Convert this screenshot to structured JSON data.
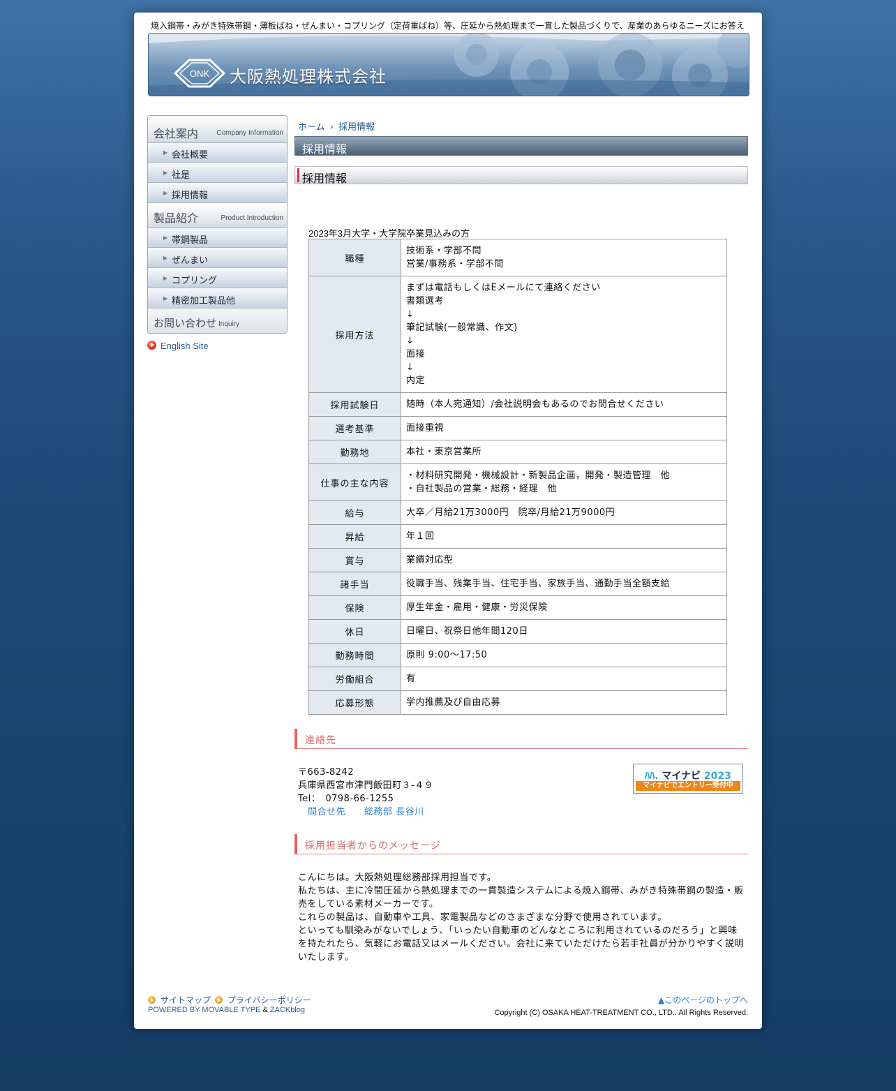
{
  "header": {
    "tagline": "焼入鋼帯・みがき特殊帯鋼・薄板ばね・ぜんまい・コプリング（定荷重ばね）等、圧延から熱処理まで一貫した製品づくりで、産業のあらゆるニーズにお答え",
    "logo_text": "ONK",
    "company_name": "大阪熱処理株式会社"
  },
  "sidebar": {
    "company": {
      "jp": "会社案内",
      "en": "Company Information"
    },
    "company_items": [
      {
        "label": "会社概要"
      },
      {
        "label": "社是"
      },
      {
        "label": "採用情報"
      }
    ],
    "products": {
      "jp": "製品紹介",
      "en": "Product Introduction"
    },
    "product_items": [
      {
        "label": "帯鋼製品"
      },
      {
        "label": "ぜんまい"
      },
      {
        "label": "コプリング"
      },
      {
        "label": "精密加工製品他"
      }
    ],
    "inquiry": {
      "jp": "お問い合わせ",
      "en": "Inquiry"
    },
    "english_link": "English Site"
  },
  "breadcrumb": {
    "home": "ホーム",
    "sep": "›",
    "current": "採用情報"
  },
  "page_title": "採用情報",
  "section_title": "採用情報",
  "table_caption": "2023年3月大学・大学院卒業見込みの方",
  "table_rows": [
    {
      "head": "職種",
      "lines": [
        "技術系・学部不問",
        "営業/事務系・学部不問"
      ]
    },
    {
      "head": "採用方法",
      "lines": [
        "まずは電話もしくはEメールにて連絡ください",
        "書類選考",
        "↓",
        "筆記試験(一般常識、作文)",
        "↓",
        "面接",
        "↓",
        "内定"
      ]
    },
    {
      "head": "採用試験日",
      "lines": [
        "随時（本人宛通知）/会社説明会もあるのでお問合せください"
      ]
    },
    {
      "head": "選考基準",
      "lines": [
        "面接重視"
      ]
    },
    {
      "head": "勤務地",
      "lines": [
        "本社・東京営業所"
      ]
    },
    {
      "head": "仕事の主な内容",
      "lines": [
        "・材料研究開発・機械設計・新製品企画，開発・製造管理　他",
        "・自社製品の営業・総務・経理　他"
      ]
    },
    {
      "head": "給与",
      "lines": [
        "大卒／月給21万3000円　院卒/月給21万9000円"
      ]
    },
    {
      "head": "昇給",
      "lines": [
        "年１回"
      ]
    },
    {
      "head": "賞与",
      "lines": [
        "業績対応型"
      ]
    },
    {
      "head": "諸手当",
      "lines": [
        "役職手当、残業手当、住宅手当、家族手当、通勤手当全額支給"
      ]
    },
    {
      "head": "保険",
      "lines": [
        "厚生年金・雇用・健康・労災保険"
      ]
    },
    {
      "head": "休日",
      "lines": [
        "日曜日、祝祭日他年間120日"
      ]
    },
    {
      "head": "勤務時間",
      "lines": [
        "原則 9:00～17:50"
      ]
    },
    {
      "head": "労働組合",
      "lines": [
        "有"
      ]
    },
    {
      "head": "応募形態",
      "lines": [
        "学内推薦及び自由応募"
      ]
    }
  ],
  "contact": {
    "heading": "連絡先",
    "postal": "〒663-8242",
    "address": "兵庫県西宮市津門飯田町３-４９",
    "tel": "Tel：　0798-66-1255",
    "link": "問合せ先　　総務部 長谷川"
  },
  "mynavi": {
    "brand": "マイナビ",
    "year": "2023",
    "entry": "マイナビでエントリー受付中"
  },
  "message": {
    "heading": "採用担当者からのメッセージ",
    "paragraphs": [
      "こんにちは。大阪熱処理総務部採用担当です。",
      "私たちは、主に冷間圧延から熱処理までの一貫製造システムによる焼入鋼帯、みがき特殊帯鋼の製造・販売をしている素材メーカーです。",
      "これらの製品は、自動車や工具、家電製品などのさまざまな分野で使用されています。",
      "といっても馴染みがないでしょう、「いったい自動車のどんなところに利用されているのだろう」と興味を持たれたら、気軽にお電話又はメールください。会社に来ていただけたら若手社員が分かりやすく説明いたします。"
    ]
  },
  "footer": {
    "sitemap": "サイトマップ",
    "privacy": "プライバシーポリシー",
    "powered_prefix": "POWERED BY MOVABLE TYPE",
    "powered_amp": "&",
    "powered_suffix": "ZACKblog",
    "to_top": "▲このページのトップへ",
    "copyright": "Copyright (C) OSAKA HEAT-TREATMENT CO., LTD.. All Rights Reserved."
  },
  "colors": {
    "background": "#1d4a78",
    "accent_red": "#e06a6a",
    "link_blue": "#2b5e92",
    "table_head_bg": "#e3e9f0"
  }
}
